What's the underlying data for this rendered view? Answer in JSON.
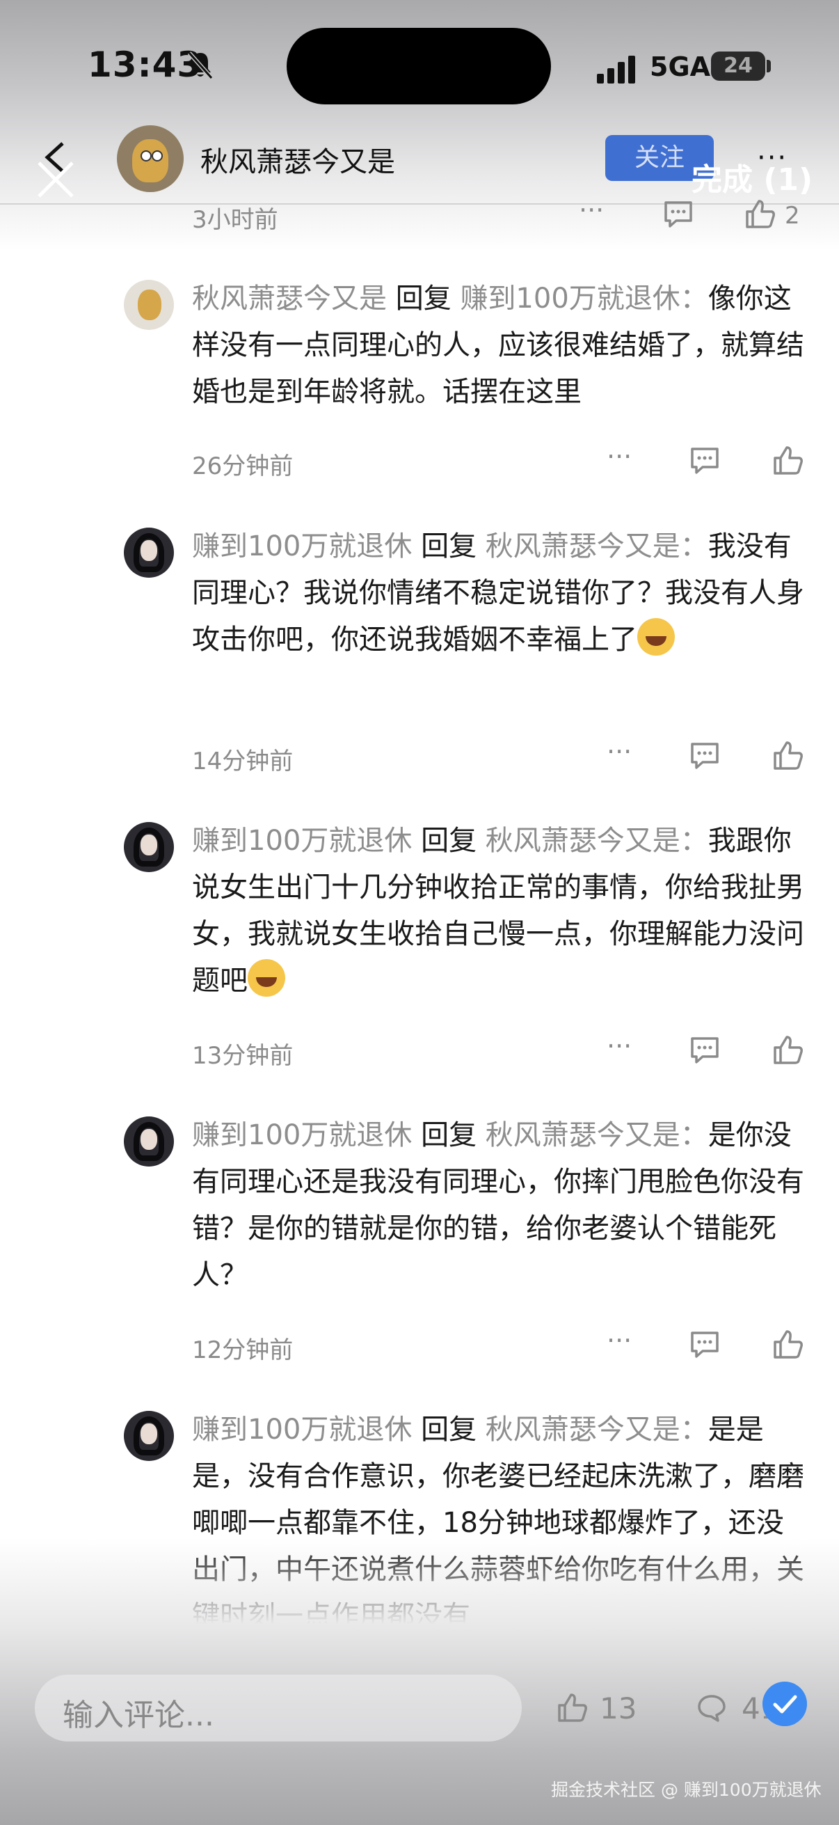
{
  "status_bar": {
    "time": "13:43",
    "network": "5GA",
    "battery": "24"
  },
  "header": {
    "username": "秋风萧瑟今又是",
    "follow_label": "关注",
    "done_label": "完成 (1)"
  },
  "prev_comment": {
    "time": "3小时前",
    "like_count": "2"
  },
  "reply_word": "回复",
  "comments": [
    {
      "author": "秋风萧瑟今又是",
      "reply_to": "赚到100万就退休",
      "text": "像你这样没有一点同理心的人，应该很难结婚了，就算结婚也是到年龄将就。话摆在这里",
      "time": "26分钟前"
    },
    {
      "author": "赚到100万就退休",
      "reply_to": "秋风萧瑟今又是",
      "text": "我没有同理心？我说你情绪不稳定说错你了？我没有人身攻击你吧，你还说我婚姻不幸福上了",
      "time": "14分钟前"
    },
    {
      "author": "赚到100万就退休",
      "reply_to": "秋风萧瑟今又是",
      "text": "我跟你说女生出门十几分钟收拾正常的事情，你给我扯男女，我就说女生收拾自己慢一点，你理解能力没问题吧",
      "time": "13分钟前"
    },
    {
      "author": "赚到100万就退休",
      "reply_to": "秋风萧瑟今又是",
      "text": "是你没有同理心还是我没有同理心，你摔门甩脸色你没有错？是你的错就是你的错，给你老婆认个错能死人？",
      "time": "12分钟前"
    },
    {
      "author": "赚到100万就退休",
      "reply_to": "秋风萧瑟今又是",
      "text": "是是是，没有合作意识，你老婆已经起床洗漱了，磨磨唧唧一点都靠不住，18分钟地球都爆炸了，还没出门，中午还说煮什么蒜蓉虾给你吃有什么用，关键时刻一点作用都没有",
      "time": ""
    }
  ],
  "bottom_bar": {
    "input_placeholder": "输入评论...",
    "like_count": "13",
    "comment_count": "41"
  },
  "watermark": "掘金技术社区 @ 赚到100万就退休",
  "colors": {
    "accent_blue": "#3f6fd1",
    "username_gray": "#8d8d8d",
    "check_blue": "#3d8bf2"
  },
  "icons": [
    "bell-off-icon",
    "signal-icon",
    "battery-icon",
    "back-icon",
    "close-icon",
    "more-icon",
    "reply-icon",
    "like-icon",
    "comment-icon",
    "check-icon"
  ]
}
